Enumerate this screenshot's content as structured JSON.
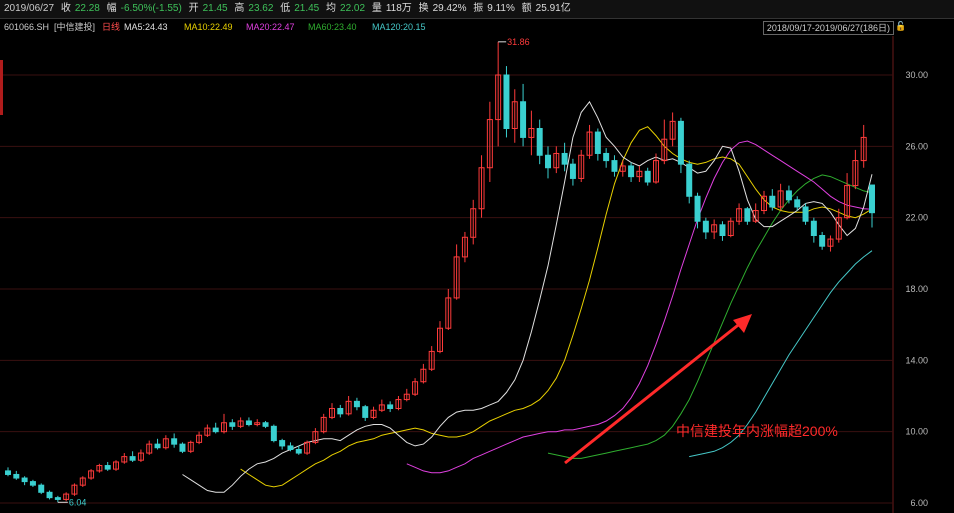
{
  "header": {
    "date": "2019/06/27",
    "close_label": "收",
    "close": "22.28",
    "change_label": "幅",
    "change": "-6.50%(-1.55)",
    "open_label": "开",
    "open": "21.45",
    "high_label": "高",
    "high": "23.62",
    "low_label": "低",
    "low": "21.45",
    "avg_label": "均",
    "avg": "22.02",
    "vol_label": "量",
    "vol": "118万",
    "turnover_label": "换",
    "turnover": "29.42%",
    "amplitude_label": "振",
    "amplitude": "9.11%",
    "amount_label": "额",
    "amount": "25.91亿"
  },
  "legend": {
    "code": "601066.SH",
    "name": "[中信建投]",
    "period": "日线",
    "ma5": "MA5:24.43",
    "ma10": "MA10:22.49",
    "ma20": "MA20:22.47",
    "ma60": "MA60:23.40",
    "ma120": "MA120:20.15",
    "range": "2018/09/17-2019/06/27(186日)"
  },
  "colors": {
    "up": "#ff3b3b",
    "down": "#3ad0d0",
    "ma5": "#e0e0e0",
    "ma10": "#e8d000",
    "ma20": "#e040e0",
    "ma60": "#2fae2f",
    "ma120": "#46c8c8",
    "grid": "#3a1010",
    "annotation": "#ff2a2a"
  },
  "chart_data": {
    "type": "candlestick",
    "y_ticks": [
      "30.00",
      "26.00",
      "22.00",
      "18.00",
      "14.00",
      "10.00",
      "6.00"
    ],
    "ylim": [
      6,
      30
    ],
    "grid": true,
    "high_label": "31.86",
    "low_label": "6.04",
    "annotation": "中信建投年内涨幅超200%",
    "candles": [
      [
        7.8,
        7.6,
        8.0,
        7.5
      ],
      [
        7.6,
        7.4,
        7.8,
        7.3
      ],
      [
        7.4,
        7.2,
        7.5,
        7.0
      ],
      [
        7.2,
        7.0,
        7.3,
        6.9
      ],
      [
        7.0,
        6.6,
        7.1,
        6.5
      ],
      [
        6.6,
        6.3,
        6.7,
        6.2
      ],
      [
        6.3,
        6.2,
        6.4,
        6.04
      ],
      [
        6.2,
        6.5,
        6.6,
        6.1
      ],
      [
        6.5,
        7.0,
        7.1,
        6.4
      ],
      [
        7.0,
        7.4,
        7.5,
        6.9
      ],
      [
        7.4,
        7.8,
        7.9,
        7.3
      ],
      [
        7.8,
        8.1,
        8.2,
        7.7
      ],
      [
        8.1,
        7.9,
        8.3,
        7.8
      ],
      [
        7.9,
        8.3,
        8.4,
        7.8
      ],
      [
        8.3,
        8.6,
        8.8,
        8.2
      ],
      [
        8.6,
        8.4,
        8.9,
        8.3
      ],
      [
        8.4,
        8.8,
        9.0,
        8.3
      ],
      [
        8.8,
        9.3,
        9.5,
        8.7
      ],
      [
        9.3,
        9.1,
        9.6,
        9.0
      ],
      [
        9.1,
        9.6,
        9.8,
        9.0
      ],
      [
        9.6,
        9.3,
        9.9,
        9.1
      ],
      [
        9.3,
        8.9,
        9.4,
        8.8
      ],
      [
        8.9,
        9.4,
        9.5,
        8.8
      ],
      [
        9.4,
        9.8,
        10.0,
        9.3
      ],
      [
        9.8,
        10.2,
        10.4,
        9.7
      ],
      [
        10.2,
        10.0,
        10.5,
        9.9
      ],
      [
        10.0,
        10.5,
        11.0,
        9.9
      ],
      [
        10.5,
        10.3,
        10.7,
        10.1
      ],
      [
        10.3,
        10.6,
        10.8,
        10.2
      ],
      [
        10.6,
        10.4,
        10.8,
        10.3
      ],
      [
        10.4,
        10.5,
        10.7,
        10.3
      ],
      [
        10.5,
        10.3,
        10.6,
        10.2
      ],
      [
        10.3,
        9.5,
        10.4,
        9.4
      ],
      [
        9.5,
        9.2,
        9.6,
        9.0
      ],
      [
        9.2,
        9.0,
        9.4,
        8.9
      ],
      [
        9.0,
        8.8,
        9.2,
        8.7
      ],
      [
        8.8,
        9.4,
        9.5,
        8.7
      ],
      [
        9.4,
        10.0,
        10.2,
        9.3
      ],
      [
        10.0,
        10.8,
        11.0,
        9.9
      ],
      [
        10.8,
        11.3,
        11.6,
        10.7
      ],
      [
        11.3,
        11.0,
        11.5,
        10.8
      ],
      [
        11.0,
        11.7,
        12.0,
        10.9
      ],
      [
        11.7,
        11.4,
        11.9,
        11.2
      ],
      [
        11.4,
        10.8,
        11.5,
        10.6
      ],
      [
        10.8,
        11.2,
        11.4,
        10.7
      ],
      [
        11.2,
        11.5,
        11.8,
        11.1
      ],
      [
        11.5,
        11.3,
        11.7,
        11.1
      ],
      [
        11.3,
        11.8,
        12.0,
        11.2
      ],
      [
        11.8,
        12.1,
        12.4,
        11.7
      ],
      [
        12.1,
        12.8,
        13.0,
        12.0
      ],
      [
        12.8,
        13.5,
        13.8,
        12.7
      ],
      [
        13.5,
        14.5,
        14.8,
        13.4
      ],
      [
        14.5,
        15.8,
        16.2,
        14.4
      ],
      [
        15.8,
        17.5,
        18.0,
        15.7
      ],
      [
        17.5,
        19.8,
        20.5,
        17.4
      ],
      [
        19.8,
        20.9,
        21.2,
        19.5
      ],
      [
        20.9,
        22.5,
        23.0,
        20.5
      ],
      [
        22.5,
        24.8,
        25.5,
        22.0
      ],
      [
        24.8,
        27.5,
        28.5,
        24.0
      ],
      [
        27.5,
        30.0,
        31.86,
        26.0
      ],
      [
        30.0,
        27.0,
        30.5,
        26.5
      ],
      [
        27.0,
        28.5,
        29.2,
        26.2
      ],
      [
        28.5,
        26.5,
        29.5,
        26.0
      ],
      [
        26.5,
        27.0,
        28.0,
        25.5
      ],
      [
        27.0,
        25.5,
        27.5,
        25.0
      ],
      [
        25.5,
        24.8,
        26.0,
        24.2
      ],
      [
        24.8,
        25.6,
        26.0,
        24.5
      ],
      [
        25.6,
        25.0,
        26.2,
        24.6
      ],
      [
        25.0,
        24.2,
        25.3,
        23.8
      ],
      [
        24.2,
        25.5,
        25.8,
        24.0
      ],
      [
        25.5,
        26.8,
        27.2,
        25.3
      ],
      [
        26.8,
        25.6,
        27.0,
        25.2
      ],
      [
        25.6,
        25.2,
        25.9,
        24.8
      ],
      [
        25.2,
        24.6,
        25.5,
        24.3
      ],
      [
        24.6,
        24.9,
        25.2,
        24.3
      ],
      [
        24.9,
        24.3,
        25.1,
        24.0
      ],
      [
        24.3,
        24.6,
        24.9,
        24.0
      ],
      [
        24.6,
        24.0,
        24.8,
        23.8
      ],
      [
        24.0,
        25.2,
        25.6,
        23.9
      ],
      [
        25.2,
        26.4,
        27.5,
        25.0
      ],
      [
        26.4,
        27.4,
        27.9,
        26.0
      ],
      [
        27.4,
        25.0,
        27.6,
        24.5
      ],
      [
        25.0,
        23.2,
        25.2,
        22.8
      ],
      [
        23.2,
        21.8,
        23.4,
        21.4
      ],
      [
        21.8,
        21.2,
        22.0,
        20.8
      ],
      [
        21.2,
        21.6,
        21.9,
        20.8
      ],
      [
        21.6,
        21.0,
        21.8,
        20.7
      ],
      [
        21.0,
        21.8,
        22.0,
        20.9
      ],
      [
        21.8,
        22.5,
        22.8,
        21.6
      ],
      [
        22.5,
        21.8,
        22.6,
        21.6
      ],
      [
        21.8,
        22.4,
        22.8,
        21.7
      ],
      [
        22.4,
        23.2,
        23.5,
        22.2
      ],
      [
        23.2,
        22.6,
        23.6,
        22.4
      ],
      [
        22.6,
        23.5,
        23.9,
        22.4
      ],
      [
        23.5,
        23.0,
        23.8,
        22.8
      ],
      [
        23.0,
        22.6,
        23.2,
        22.4
      ],
      [
        22.6,
        21.8,
        22.8,
        21.6
      ],
      [
        21.8,
        21.0,
        22.0,
        20.6
      ],
      [
        21.0,
        20.4,
        21.2,
        20.2
      ],
      [
        20.4,
        20.8,
        21.0,
        20.1
      ],
      [
        20.8,
        22.0,
        22.5,
        20.6
      ],
      [
        22.0,
        23.8,
        24.5,
        21.9
      ],
      [
        23.8,
        25.2,
        25.8,
        23.6
      ],
      [
        25.2,
        26.5,
        27.2,
        24.8
      ],
      [
        23.83,
        22.28,
        23.62,
        21.45
      ]
    ],
    "ma_lines": {
      "ma5": [
        7.6,
        7.3,
        7.0,
        6.7,
        6.6,
        6.6,
        7.0,
        7.5,
        7.9,
        8.2,
        8.3,
        8.5,
        8.8,
        9.0,
        9.2,
        9.4,
        9.5,
        9.6,
        9.6,
        9.5,
        9.8,
        10.1,
        10.3,
        10.4,
        10.4,
        10.2,
        9.8,
        9.4,
        9.2,
        9.3,
        9.7,
        10.3,
        10.8,
        11.1,
        11.2,
        11.2,
        11.3,
        11.5,
        11.7,
        12.2,
        12.9,
        14.0,
        15.6,
        17.4,
        19.3,
        21.6,
        24.0,
        26.5,
        27.9,
        28.5,
        27.6,
        26.5,
        26.0,
        25.4,
        25.1,
        24.9,
        25.2,
        25.4,
        25.2,
        25.3,
        25.1,
        24.8,
        24.5,
        24.6,
        25.2,
        26.0,
        25.9,
        24.6,
        23.0,
        21.9,
        21.5,
        21.5,
        21.8,
        22.1,
        22.4,
        22.8,
        22.9,
        22.8,
        22.3,
        21.6,
        21.0,
        21.4,
        22.6,
        24.43
      ],
      "ma10": [
        7.9,
        7.6,
        7.3,
        7.0,
        6.9,
        7.0,
        7.3,
        7.6,
        7.9,
        8.2,
        8.4,
        8.7,
        8.9,
        9.2,
        9.4,
        9.5,
        9.6,
        9.8,
        9.9,
        10.0,
        10.1,
        10.2,
        10.1,
        9.9,
        9.8,
        9.7,
        9.7,
        9.8,
        10.0,
        10.3,
        10.6,
        10.8,
        11.0,
        11.2,
        11.3,
        11.5,
        11.8,
        12.3,
        13.0,
        14.0,
        15.4,
        16.9,
        18.5,
        20.3,
        22.2,
        23.9,
        25.2,
        26.2,
        26.9,
        27.1,
        26.6,
        26.0,
        25.6,
        25.3,
        25.1,
        25.0,
        25.1,
        25.3,
        25.4,
        25.3,
        25.0,
        24.3,
        23.6,
        23.0,
        22.6,
        22.4,
        22.3,
        22.3,
        22.3,
        22.5,
        22.6,
        22.5,
        22.3,
        22.1,
        22.0,
        22.2,
        22.49
      ],
      "ma20": [
        8.2,
        8.0,
        7.8,
        7.7,
        7.7,
        7.8,
        8.0,
        8.2,
        8.5,
        8.7,
        8.9,
        9.1,
        9.3,
        9.5,
        9.7,
        9.8,
        9.9,
        10.0,
        10.0,
        10.1,
        10.1,
        10.2,
        10.3,
        10.4,
        10.6,
        10.9,
        11.3,
        11.9,
        12.7,
        13.7,
        14.9,
        16.2,
        17.6,
        19.1,
        20.5,
        21.9,
        23.1,
        24.2,
        25.1,
        25.8,
        26.2,
        26.3,
        26.1,
        25.8,
        25.5,
        25.2,
        24.9,
        24.6,
        24.3,
        24.0,
        23.6,
        23.2,
        22.9,
        22.7,
        22.6,
        22.5,
        22.47
      ],
      "ma60": [
        8.8,
        8.7,
        8.6,
        8.5,
        8.5,
        8.6,
        8.7,
        8.8,
        8.9,
        9.0,
        9.1,
        9.2,
        9.3,
        9.5,
        9.8,
        10.3,
        11.0,
        11.8,
        12.8,
        13.9,
        15.0,
        16.1,
        17.2,
        18.2,
        19.2,
        20.1,
        20.9,
        21.7,
        22.4,
        23.0,
        23.5,
        23.9,
        24.2,
        24.4,
        24.3,
        24.1,
        23.9,
        23.7,
        23.5,
        23.4
      ],
      "ma120": [
        8.6,
        8.7,
        8.8,
        8.9,
        9.1,
        9.4,
        9.8,
        10.4,
        11.1,
        11.9,
        12.7,
        13.5,
        14.3,
        15.0,
        15.7,
        16.4,
        17.1,
        17.8,
        18.4,
        18.9,
        19.4,
        19.8,
        20.15
      ]
    }
  }
}
